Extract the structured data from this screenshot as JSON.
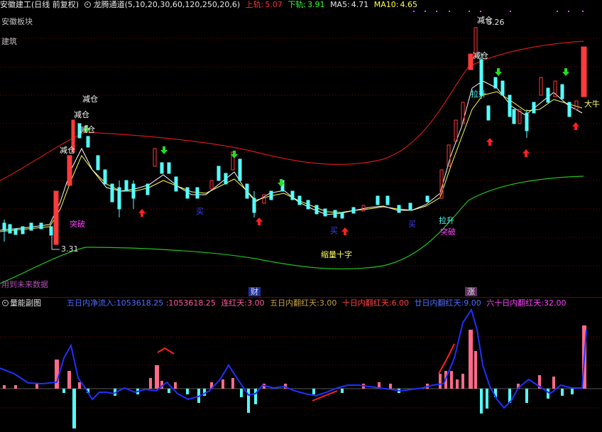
{
  "header": {
    "stock_name": "安徽建工",
    "period": "(日线 前复权)",
    "indicator_name": "龙腾通道",
    "indicator_params": "(5,10,20,30,60,120,250,20,6)",
    "upper_label": "上轨:",
    "upper_value": "5.07",
    "lower_label": "下轨:",
    "lower_value": "3.91",
    "ma5_label": "MA5:",
    "ma5_value": "4.71",
    "ma10_label": "MA10:",
    "ma10_value": "4.65"
  },
  "main_panel": {
    "board_label": "安徽板块",
    "sector_label": "建筑",
    "future_data_label": "用到未来数据",
    "price_high_label": "5.26",
    "price_low_label": "3.31",
    "annotations": {
      "reduce1": "减仓",
      "reduce2": "减仓",
      "reduce3": "减仓",
      "reduce4": "减仓",
      "reduce_top": "减仓",
      "reduce_right": "减仓",
      "breakthrough_left": "突破",
      "breakthrough_right": "突破",
      "pullup": "拉升",
      "pullup2": "拉升",
      "buy1": "买",
      "buy2": "买",
      "buy3": "买",
      "shrink_cross": "缩量十字",
      "big_bull": "大牛"
    },
    "markers": {
      "finance": "财",
      "rise": "涨"
    }
  },
  "sub_panel": {
    "title": "量能副图",
    "stats": [
      {
        "label": "五日内净流入:",
        "value": "1053618.25",
        "color": "#4f6cff"
      },
      {
        "label": ":",
        "value": "1053618.25",
        "color": "#ff5aa0"
      },
      {
        "label": "连红天:",
        "value": "3.00",
        "color": "#ff5aa0"
      },
      {
        "label": "五日内翻红天:",
        "value": "3.00",
        "color": "#c8a040"
      },
      {
        "label": "十日内翻红天:",
        "value": "6.00",
        "color": "#ff4040"
      },
      {
        "label": "廿日内翻红天:",
        "value": "9.00",
        "color": "#4f6cff"
      },
      {
        "label": "六十日内翻红天:",
        "value": "32.00",
        "color": "#ff40ff"
      }
    ]
  },
  "colors": {
    "up": "#ff3b3b",
    "down": "#54ffff",
    "upper_band": "#e02020",
    "lower_band": "#20d020",
    "ma5": "#ffffff",
    "ma10": "#ffff40",
    "flow_line": "#2030ff",
    "flow_red": "#ff2020"
  }
}
